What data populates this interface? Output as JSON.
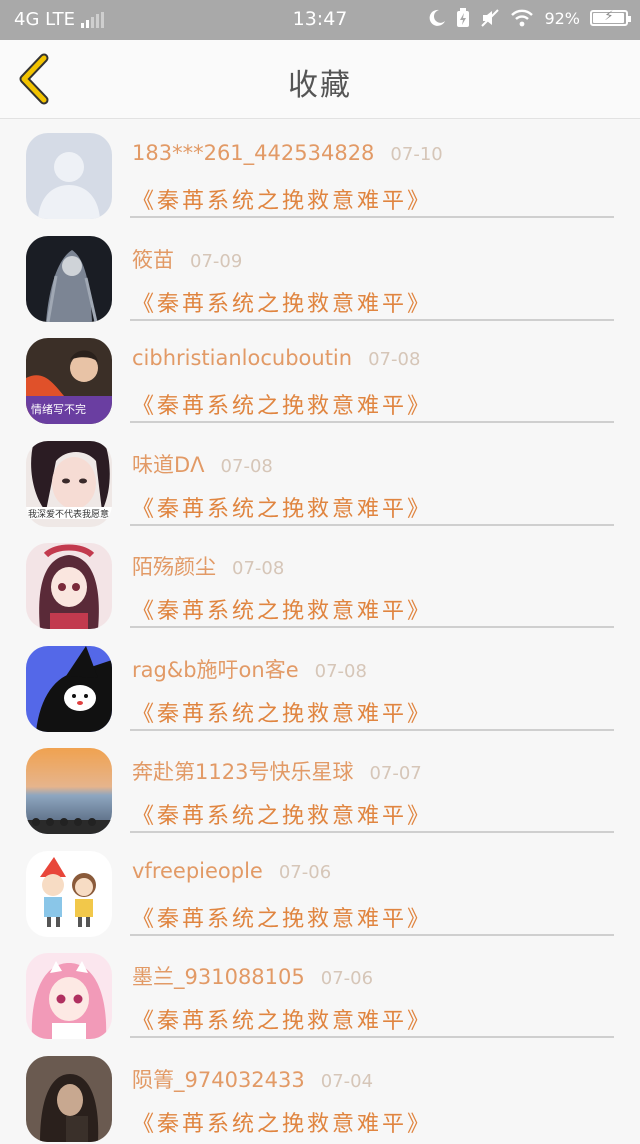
{
  "status_bar": {
    "network": "4G LTE",
    "time": "13:47",
    "battery": "92%"
  },
  "header": {
    "title": "收藏"
  },
  "items": [
    {
      "name": "183***261_442534828",
      "date": "07-10",
      "book": "《秦苒系统之挽救意难平》"
    },
    {
      "name": "筱苗",
      "date": "07-09",
      "book": "《秦苒系统之挽救意难平》"
    },
    {
      "name": "cibhristianlocuboutin",
      "date": "07-08",
      "book": "《秦苒系统之挽救意难平》"
    },
    {
      "name": "味道DΛ",
      "date": "07-08",
      "book": "《秦苒系统之挽救意难平》"
    },
    {
      "name": "陌殇颜尘",
      "date": "07-08",
      "book": "《秦苒系统之挽救意难平》"
    },
    {
      "name": "rag&b施吁on客e",
      "date": "07-08",
      "book": "《秦苒系统之挽救意难平》"
    },
    {
      "name": "奔赴第1123号快乐星球",
      "date": "07-07",
      "book": "《秦苒系统之挽救意难平》"
    },
    {
      "name": "vfreepieople",
      "date": "07-06",
      "book": "《秦苒系统之挽救意难平》"
    },
    {
      "name": "墨兰_931088105",
      "date": "07-06",
      "book": "《秦苒系统之挽救意难平》"
    },
    {
      "name": "陨箐_974032433",
      "date": "07-04",
      "book": "《秦苒系统之挽救意难平》"
    }
  ],
  "avatar_texts": {
    "a3": "情绪写不完",
    "a4": "我深爱不代表我愿意"
  },
  "colors": {
    "name": "#e29a66",
    "date": "#d6c6b8",
    "book": "#e08540",
    "back_arrow": "#f2c300"
  }
}
